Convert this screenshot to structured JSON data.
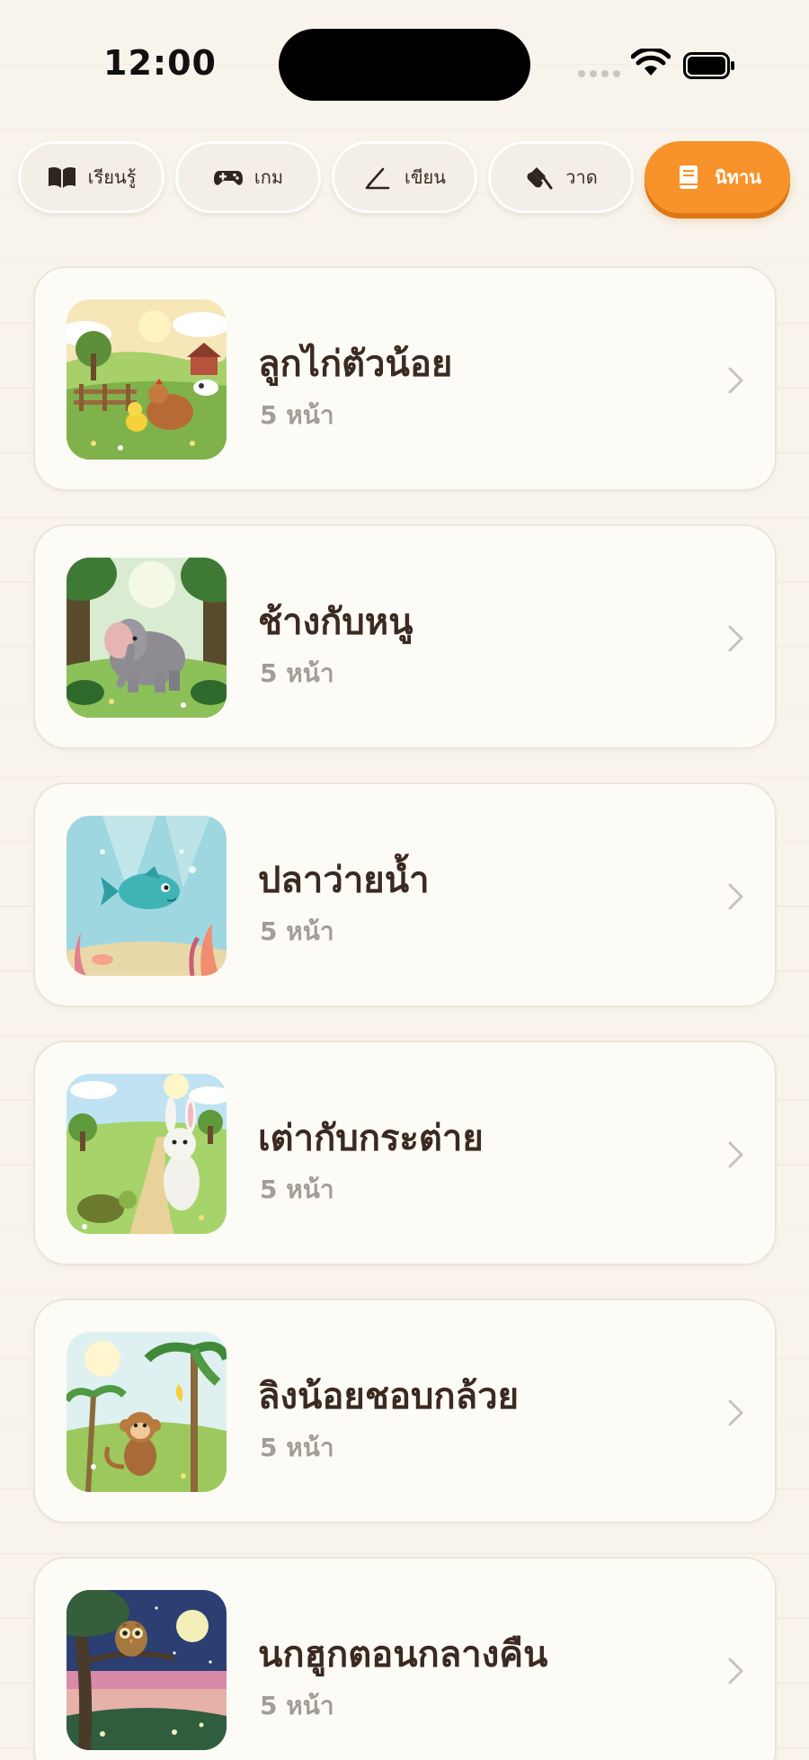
{
  "status_bar": {
    "time": "12:00"
  },
  "tabs": [
    {
      "label": "เรียนรู้",
      "icon": "book-open-icon",
      "active": false
    },
    {
      "label": "เกม",
      "icon": "gamepad-icon",
      "active": false
    },
    {
      "label": "เขียน",
      "icon": "pencil-icon",
      "active": false
    },
    {
      "label": "วาด",
      "icon": "brush-icon",
      "active": false
    },
    {
      "label": "นิทาน",
      "icon": "storybook-icon",
      "active": true
    }
  ],
  "stories": [
    {
      "title": "ลูกไก่ตัวน้อย",
      "pages": "5 หน้า",
      "thumbnail": "farm-chicken-illustration"
    },
    {
      "title": "ช้างกับหนู",
      "pages": "5 หน้า",
      "thumbnail": "forest-elephant-illustration"
    },
    {
      "title": "ปลาว่ายน้ำ",
      "pages": "5 หน้า",
      "thumbnail": "underwater-fish-illustration"
    },
    {
      "title": "เต่ากับกระต่าย",
      "pages": "5 หน้า",
      "thumbnail": "meadow-turtle-rabbit-illustration"
    },
    {
      "title": "ลิงน้อยชอบกล้วย",
      "pages": "5 หน้า",
      "thumbnail": "jungle-monkey-illustration"
    },
    {
      "title": "นกฮูกตอนกลางคืน",
      "pages": "5 หน้า",
      "thumbnail": "night-owl-illustration"
    }
  ],
  "colors": {
    "background": "#f8f4ec",
    "accent": "#f7932a",
    "card": "#fdfbf6",
    "title": "#3b2a20",
    "subtitle": "#a49d95"
  }
}
